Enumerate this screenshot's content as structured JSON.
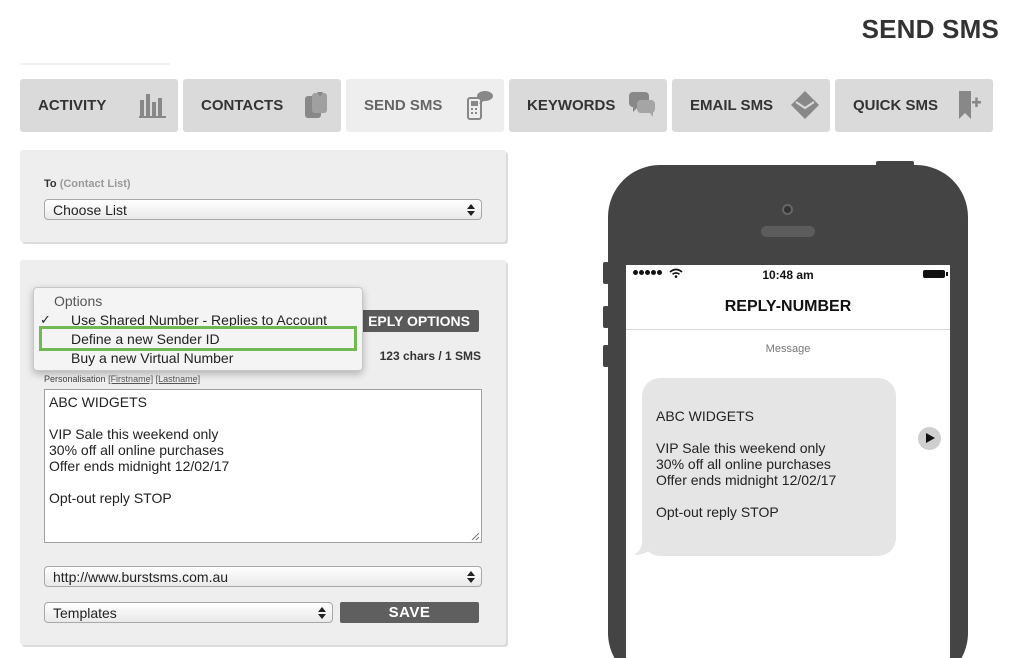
{
  "page_title": "SEND SMS",
  "tabs": [
    {
      "label": "ACTIVITY",
      "icon": "bar-chart-icon"
    },
    {
      "label": "CONTACTS",
      "icon": "contacts-cards-icon"
    },
    {
      "label": "SEND SMS",
      "icon": "phone-sms-icon",
      "active": true
    },
    {
      "label": "KEYWORDS",
      "icon": "speech-bubbles-icon"
    },
    {
      "label": "EMAIL SMS",
      "icon": "envelope-icon"
    },
    {
      "label": "QUICK SMS",
      "icon": "bookmark-plus-icon"
    }
  ],
  "recipient": {
    "to_label": "To",
    "to_hint": "(Contact List)",
    "list_select_value": "Choose List"
  },
  "compose": {
    "reply_options_label": "REPLY OPTIONS",
    "reply_options_visible": "EPLY OPTIONS",
    "char_count": "123 chars / 1 SMS",
    "personalisation_label": "Personalisation",
    "firstname_tag": "[Firstname]",
    "lastname_tag": "[Lastname]",
    "message_text": "ABC WIDGETS\n\nVIP Sale this weekend only\n30% off all online purchases\nOffer ends midnight 12/02/17\n\nOpt-out reply STOP",
    "url_select_value": "http://www.burstsms.com.au",
    "templates_select_value": "Templates",
    "save_label": "SAVE"
  },
  "options_dropdown": {
    "header": "Options",
    "check_mark": "✓",
    "items": [
      "Use Shared Number - Replies to Account",
      "Define a new Sender ID",
      "Buy a new Virtual Number"
    ],
    "selected_index": 0,
    "highlighted_index": 1
  },
  "phone_preview": {
    "time": "10:48 am",
    "sender": "REPLY-NUMBER",
    "caption": "Message",
    "message_text": "ABC WIDGETS\n\nVIP Sale this weekend only\n30% off all online purchases\nOffer ends midnight 12/02/17\n\nOpt-out reply STOP"
  },
  "colors": {
    "tab_bg": "#dadada",
    "tab_active_bg": "#eeeeee",
    "panel_bg": "#eeeeee",
    "button_dark": "#5a5a5a",
    "highlight_green": "#72b955",
    "phone_body": "#444444",
    "bubble_bg": "#e5e5e5"
  }
}
